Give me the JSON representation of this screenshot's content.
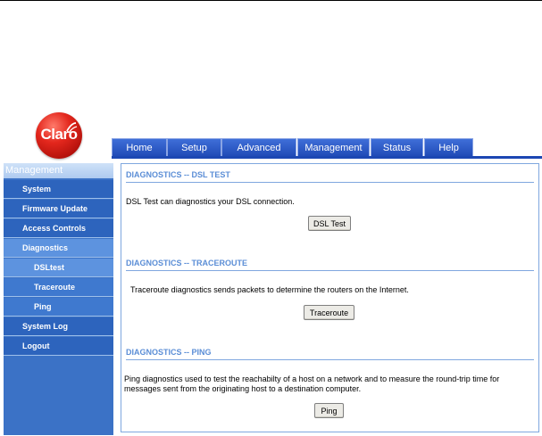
{
  "logo": {
    "text": "Claro"
  },
  "tabs": [
    "Home",
    "Setup",
    "Advanced",
    "Management",
    "Status",
    "Help"
  ],
  "sidebar": {
    "header": "Management",
    "items": [
      {
        "label": "System"
      },
      {
        "label": "Firmware Update"
      },
      {
        "label": "Access Controls"
      },
      {
        "label": "Diagnostics"
      },
      {
        "label": "DSLtest"
      },
      {
        "label": "Traceroute"
      },
      {
        "label": "Ping"
      },
      {
        "label": "System Log"
      },
      {
        "label": "Logout"
      }
    ]
  },
  "sections": {
    "dsl": {
      "title": "DIAGNOSTICS -- DSL TEST",
      "text": "DSL Test can diagnostics your DSL connection.",
      "button": "DSL Test"
    },
    "traceroute": {
      "title": "DIAGNOSTICS -- TRACEROUTE",
      "text": "Traceroute diagnostics sends packets to determine the routers on the Internet.",
      "button": "Traceroute"
    },
    "ping": {
      "title": "DIAGNOSTICS -- PING",
      "text": "Ping diagnostics used to test the reachabilty of a host on a network and to measure the round-trip time for messages sent from the originating host to a destination computer.",
      "button": "Ping"
    }
  },
  "colors": {
    "tab_blue": "#1f49b6",
    "sidebar_blue": "#2d64bd",
    "accent_light": "#5b8ed6"
  }
}
